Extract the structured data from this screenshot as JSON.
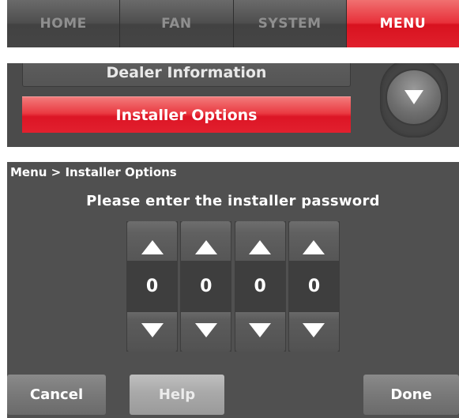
{
  "tabs": [
    {
      "label": "HOME",
      "active": false
    },
    {
      "label": "FAN",
      "active": false
    },
    {
      "label": "SYSTEM",
      "active": false
    },
    {
      "label": "MENU",
      "active": true
    }
  ],
  "menu": {
    "items": [
      {
        "label": "Dealer Information",
        "selected": false
      },
      {
        "label": "Installer Options",
        "selected": true
      }
    ],
    "scroll_icon": "chevron-down-icon"
  },
  "password_screen": {
    "breadcrumb": "Menu > Installer Options",
    "prompt": "Please enter the installer password",
    "digits": [
      "0",
      "0",
      "0",
      "0"
    ],
    "up_icon": "arrow-up-icon",
    "down_icon": "arrow-down-icon",
    "buttons": {
      "cancel": "Cancel",
      "help": "Help",
      "done": "Done"
    }
  },
  "colors": {
    "accent_red": "#e2202e",
    "panel_gray": "#505050",
    "inactive_tab_text": "#8f8f8f"
  }
}
